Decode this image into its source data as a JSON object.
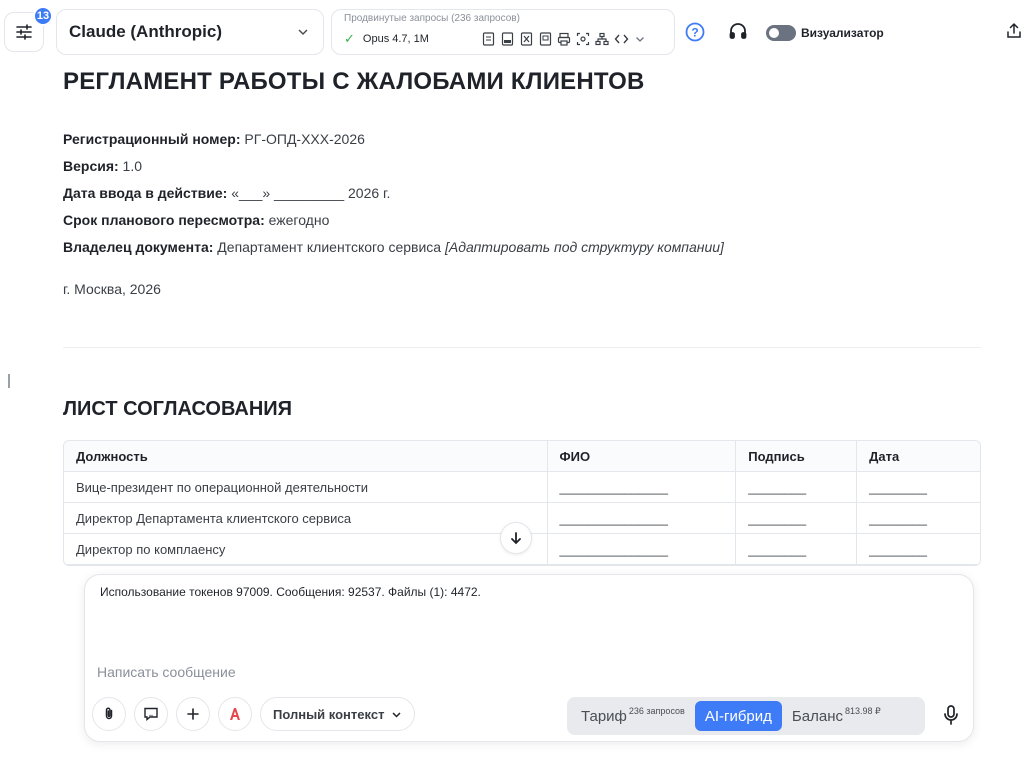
{
  "topbar": {
    "badge_count": "13",
    "model_name": "Claude (Anthropic)",
    "advanced_title": "Продвинутые запросы (236 запросов)",
    "model_version": "Opus 4.7, 1M",
    "visualizer_label": "Визуализатор"
  },
  "document": {
    "title": "РЕГЛАМЕНТ РАБОТЫ С ЖАЛОБАМИ КЛИЕНТОВ",
    "meta": [
      {
        "label": "Регистрационный номер:",
        "value": " РГ-ОПД-XXX-2026"
      },
      {
        "label": "Версия:",
        "value": " 1.0"
      },
      {
        "label": "Дата ввода в действие:",
        "value": " «___» _________ 2026 г."
      },
      {
        "label": "Срок планового пересмотра:",
        "value": " ежегодно"
      },
      {
        "label": "Владелец документа:",
        "value": " Департамент клиентского сервиса ",
        "note": "[Адаптировать под структуру компании]"
      }
    ],
    "city": "г. Москва, 2026",
    "section_title": "ЛИСТ СОГЛАСОВАНИЯ",
    "table": {
      "headers": [
        "Должность",
        "ФИО",
        "Подпись",
        "Дата"
      ],
      "rows": [
        [
          "Вице-президент по операционной деятельности",
          "_______________",
          "________",
          "________"
        ],
        [
          "Директор Департамента клиентского сервиса",
          "_______________",
          "________",
          "________"
        ],
        [
          "Директор по комплаенсу",
          "_______________",
          "________",
          "________"
        ]
      ]
    }
  },
  "composer": {
    "usage": "Использование токенов 97009. Сообщения: 92537. Файлы (1): 4472.",
    "placeholder": "Написать сообщение",
    "context_label": "Полный контекст",
    "tariff_label": "Тариф",
    "tariff_sup": "236 запросов",
    "hybrid_label": "AI-гибрид",
    "balance_label": "Баланс",
    "balance_sup": "813.98 ₽"
  },
  "colors": {
    "accent": "#3d7bf7",
    "check": "#35b24a"
  }
}
